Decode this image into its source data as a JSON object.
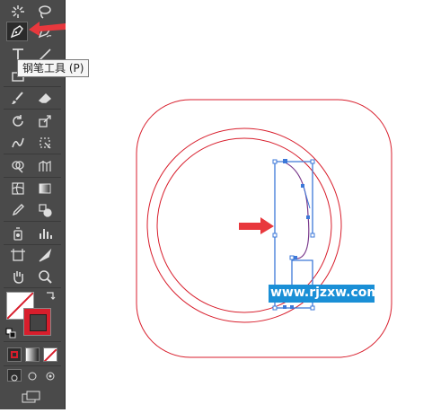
{
  "tooltip": {
    "label": "钢笔工具 (P)"
  },
  "watermark": {
    "text": "www.rjzxw.com"
  },
  "colors": {
    "toolbar_bg": "#4a4a4a",
    "shape_stroke": "#d81e2c",
    "path_stroke": "#3c78d8",
    "curve_stroke": "#7a3a8c",
    "arrow": "#e8383d",
    "stroke_swatch": "#d81e2c",
    "watermark_bg": "#1a8fd6"
  },
  "tools": [
    "magic-wand-icon",
    "lasso-icon",
    "pen-tool-icon",
    "curvature-pen-icon",
    "type-tool-icon",
    "line-segment-icon",
    "rectangle-tool-icon",
    "paintbrush-icon",
    "pencil-icon",
    "eraser-icon",
    "rotate-icon",
    "scale-icon",
    "warp-icon",
    "free-transform-icon",
    "shape-builder-icon",
    "perspective-grid-icon",
    "mesh-icon",
    "gradient-icon",
    "eyedropper-icon",
    "blend-icon",
    "symbol-sprayer-icon",
    "column-graph-icon",
    "artboard-icon",
    "slice-icon",
    "hand-icon",
    "zoom-icon"
  ]
}
